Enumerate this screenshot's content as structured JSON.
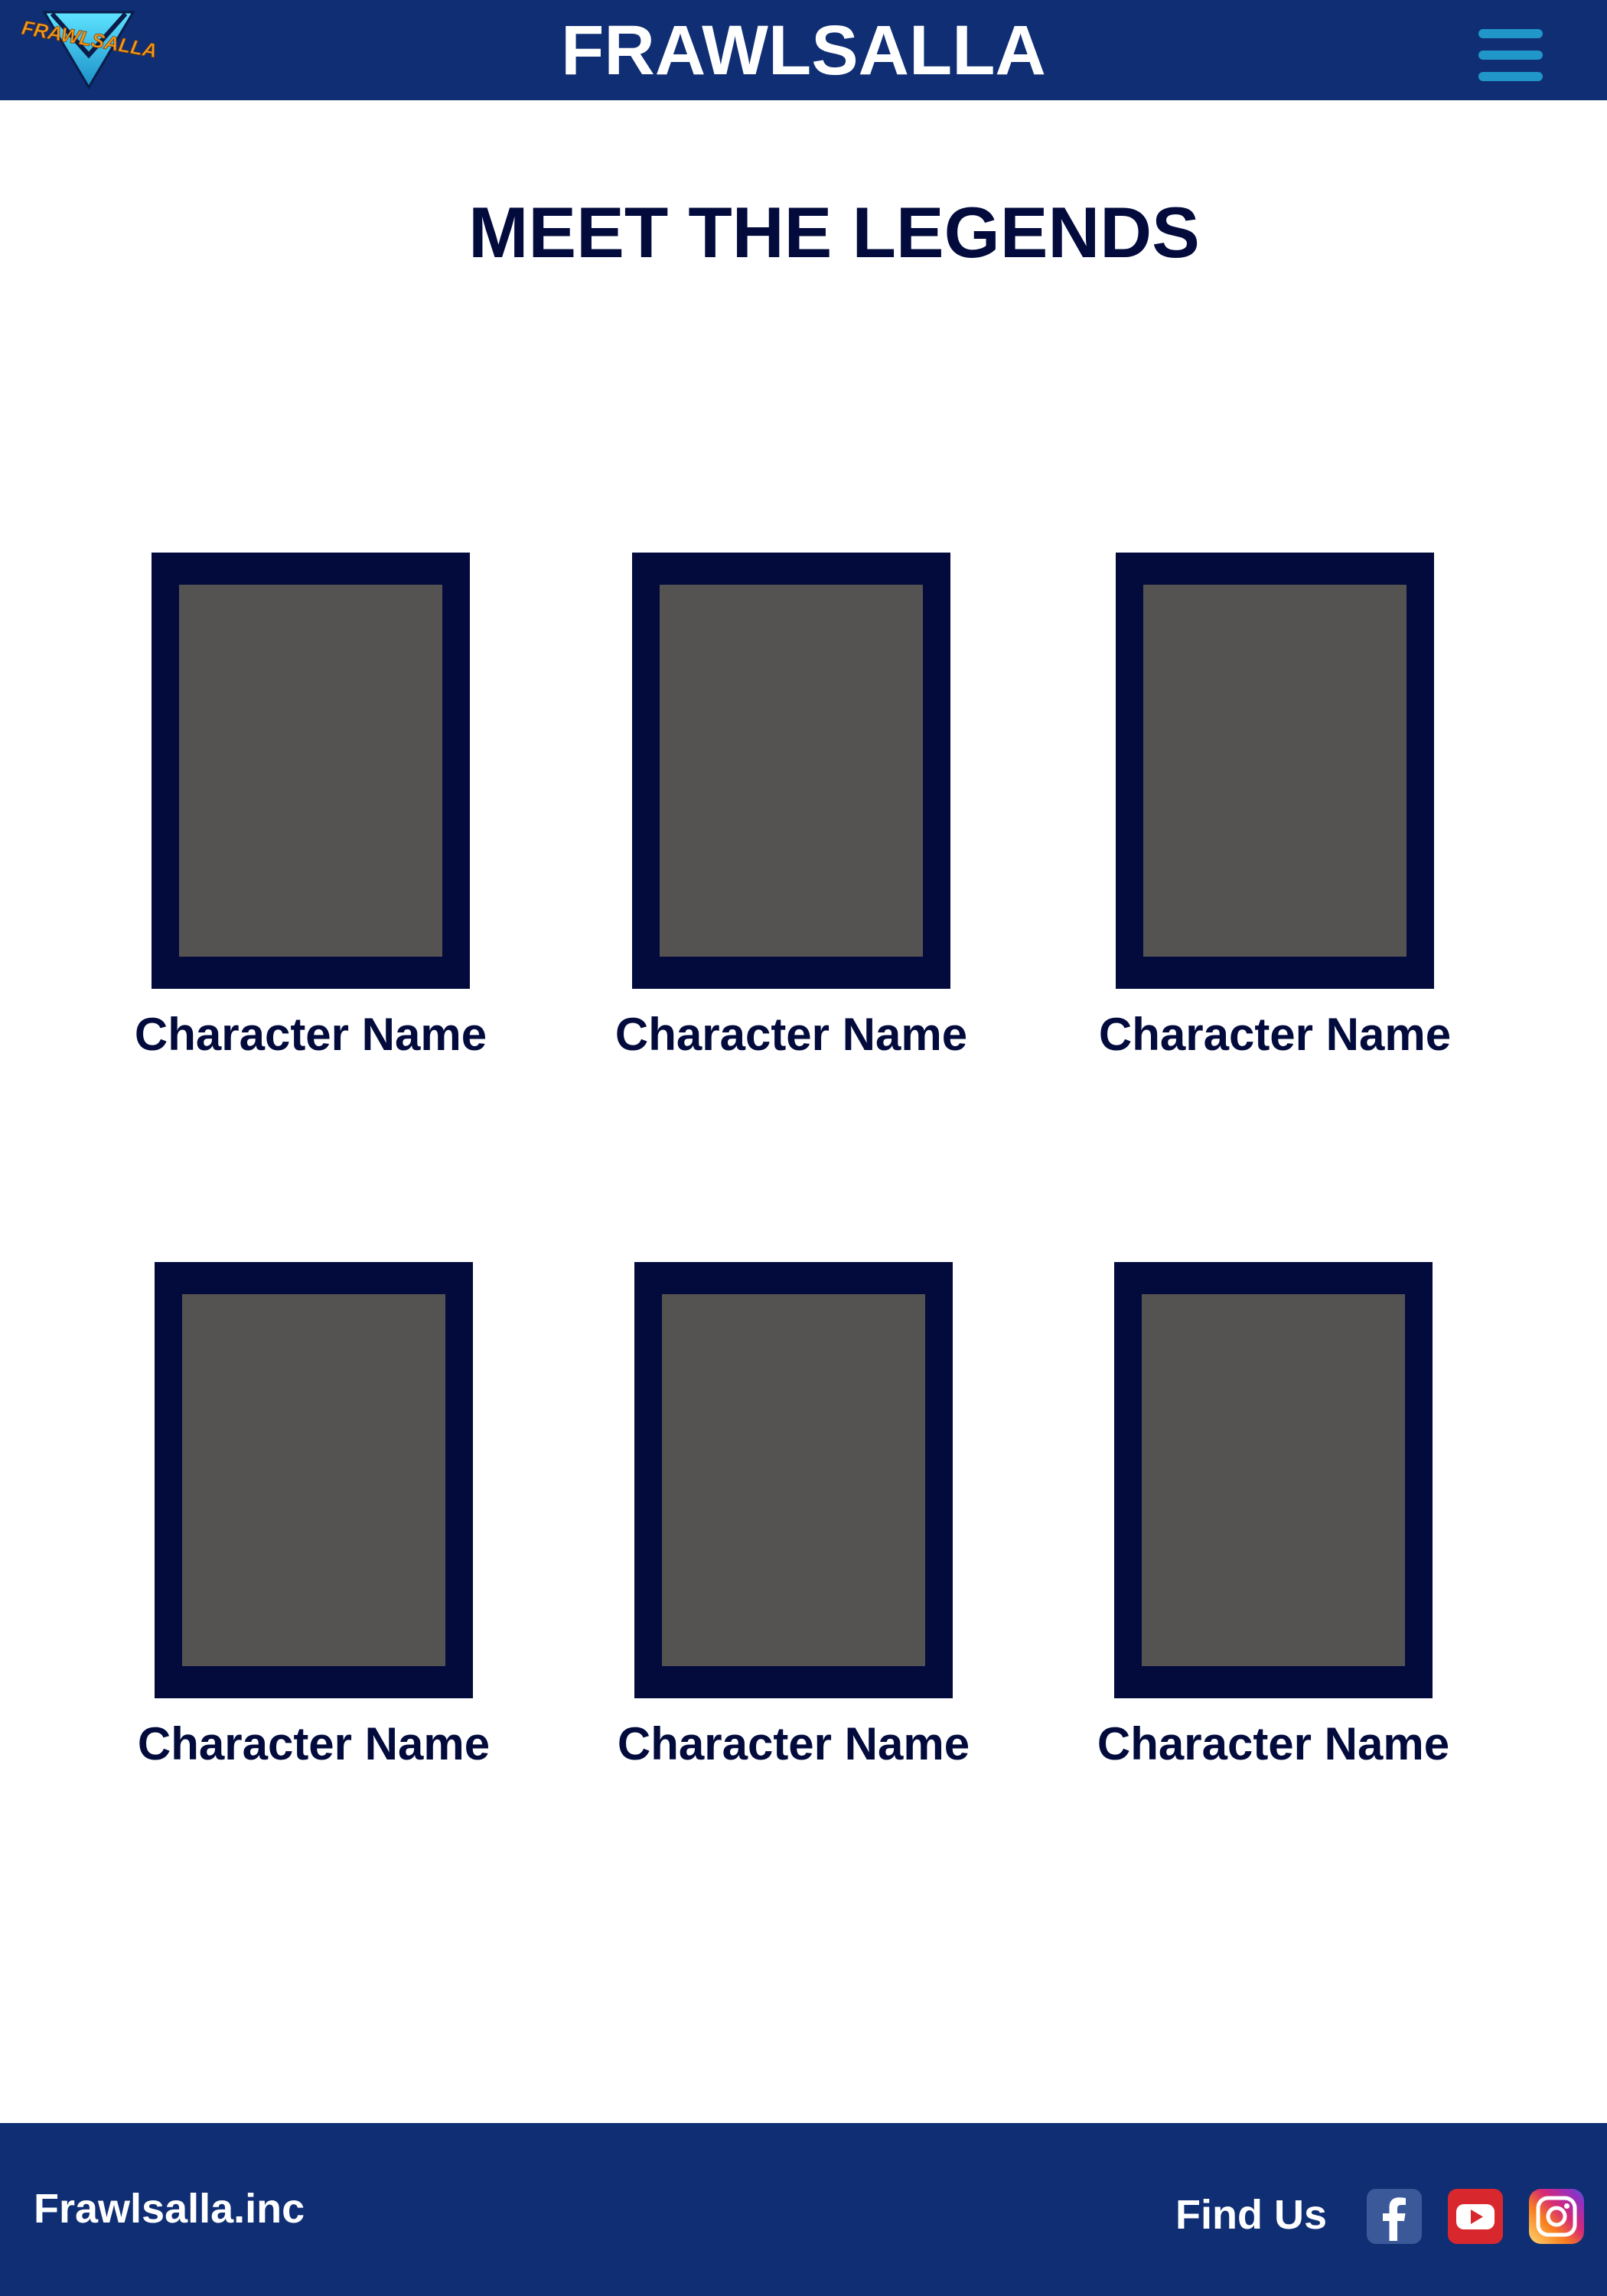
{
  "header": {
    "logo_text": "FRAWLSALLA",
    "title": "FRAWLSALLA",
    "menu_icon": "hamburger-menu-icon"
  },
  "main": {
    "heading": "MEET THE LEGENDS",
    "legends": [
      {
        "name": "Character Name"
      },
      {
        "name": "Character Name"
      },
      {
        "name": "Character Name"
      },
      {
        "name": "Character Name"
      },
      {
        "name": "Character Name"
      },
      {
        "name": "Character Name"
      }
    ]
  },
  "footer": {
    "company": "Frawlsalla.inc",
    "find_us": "Find Us",
    "social": [
      {
        "icon": "facebook-icon"
      },
      {
        "icon": "youtube-icon"
      },
      {
        "icon": "instagram-icon"
      }
    ]
  },
  "colors": {
    "header_bg": "#0f2e73",
    "navy": "#020b3c",
    "portrait_placeholder": "#555352",
    "menu_accent": "#2196c8"
  }
}
